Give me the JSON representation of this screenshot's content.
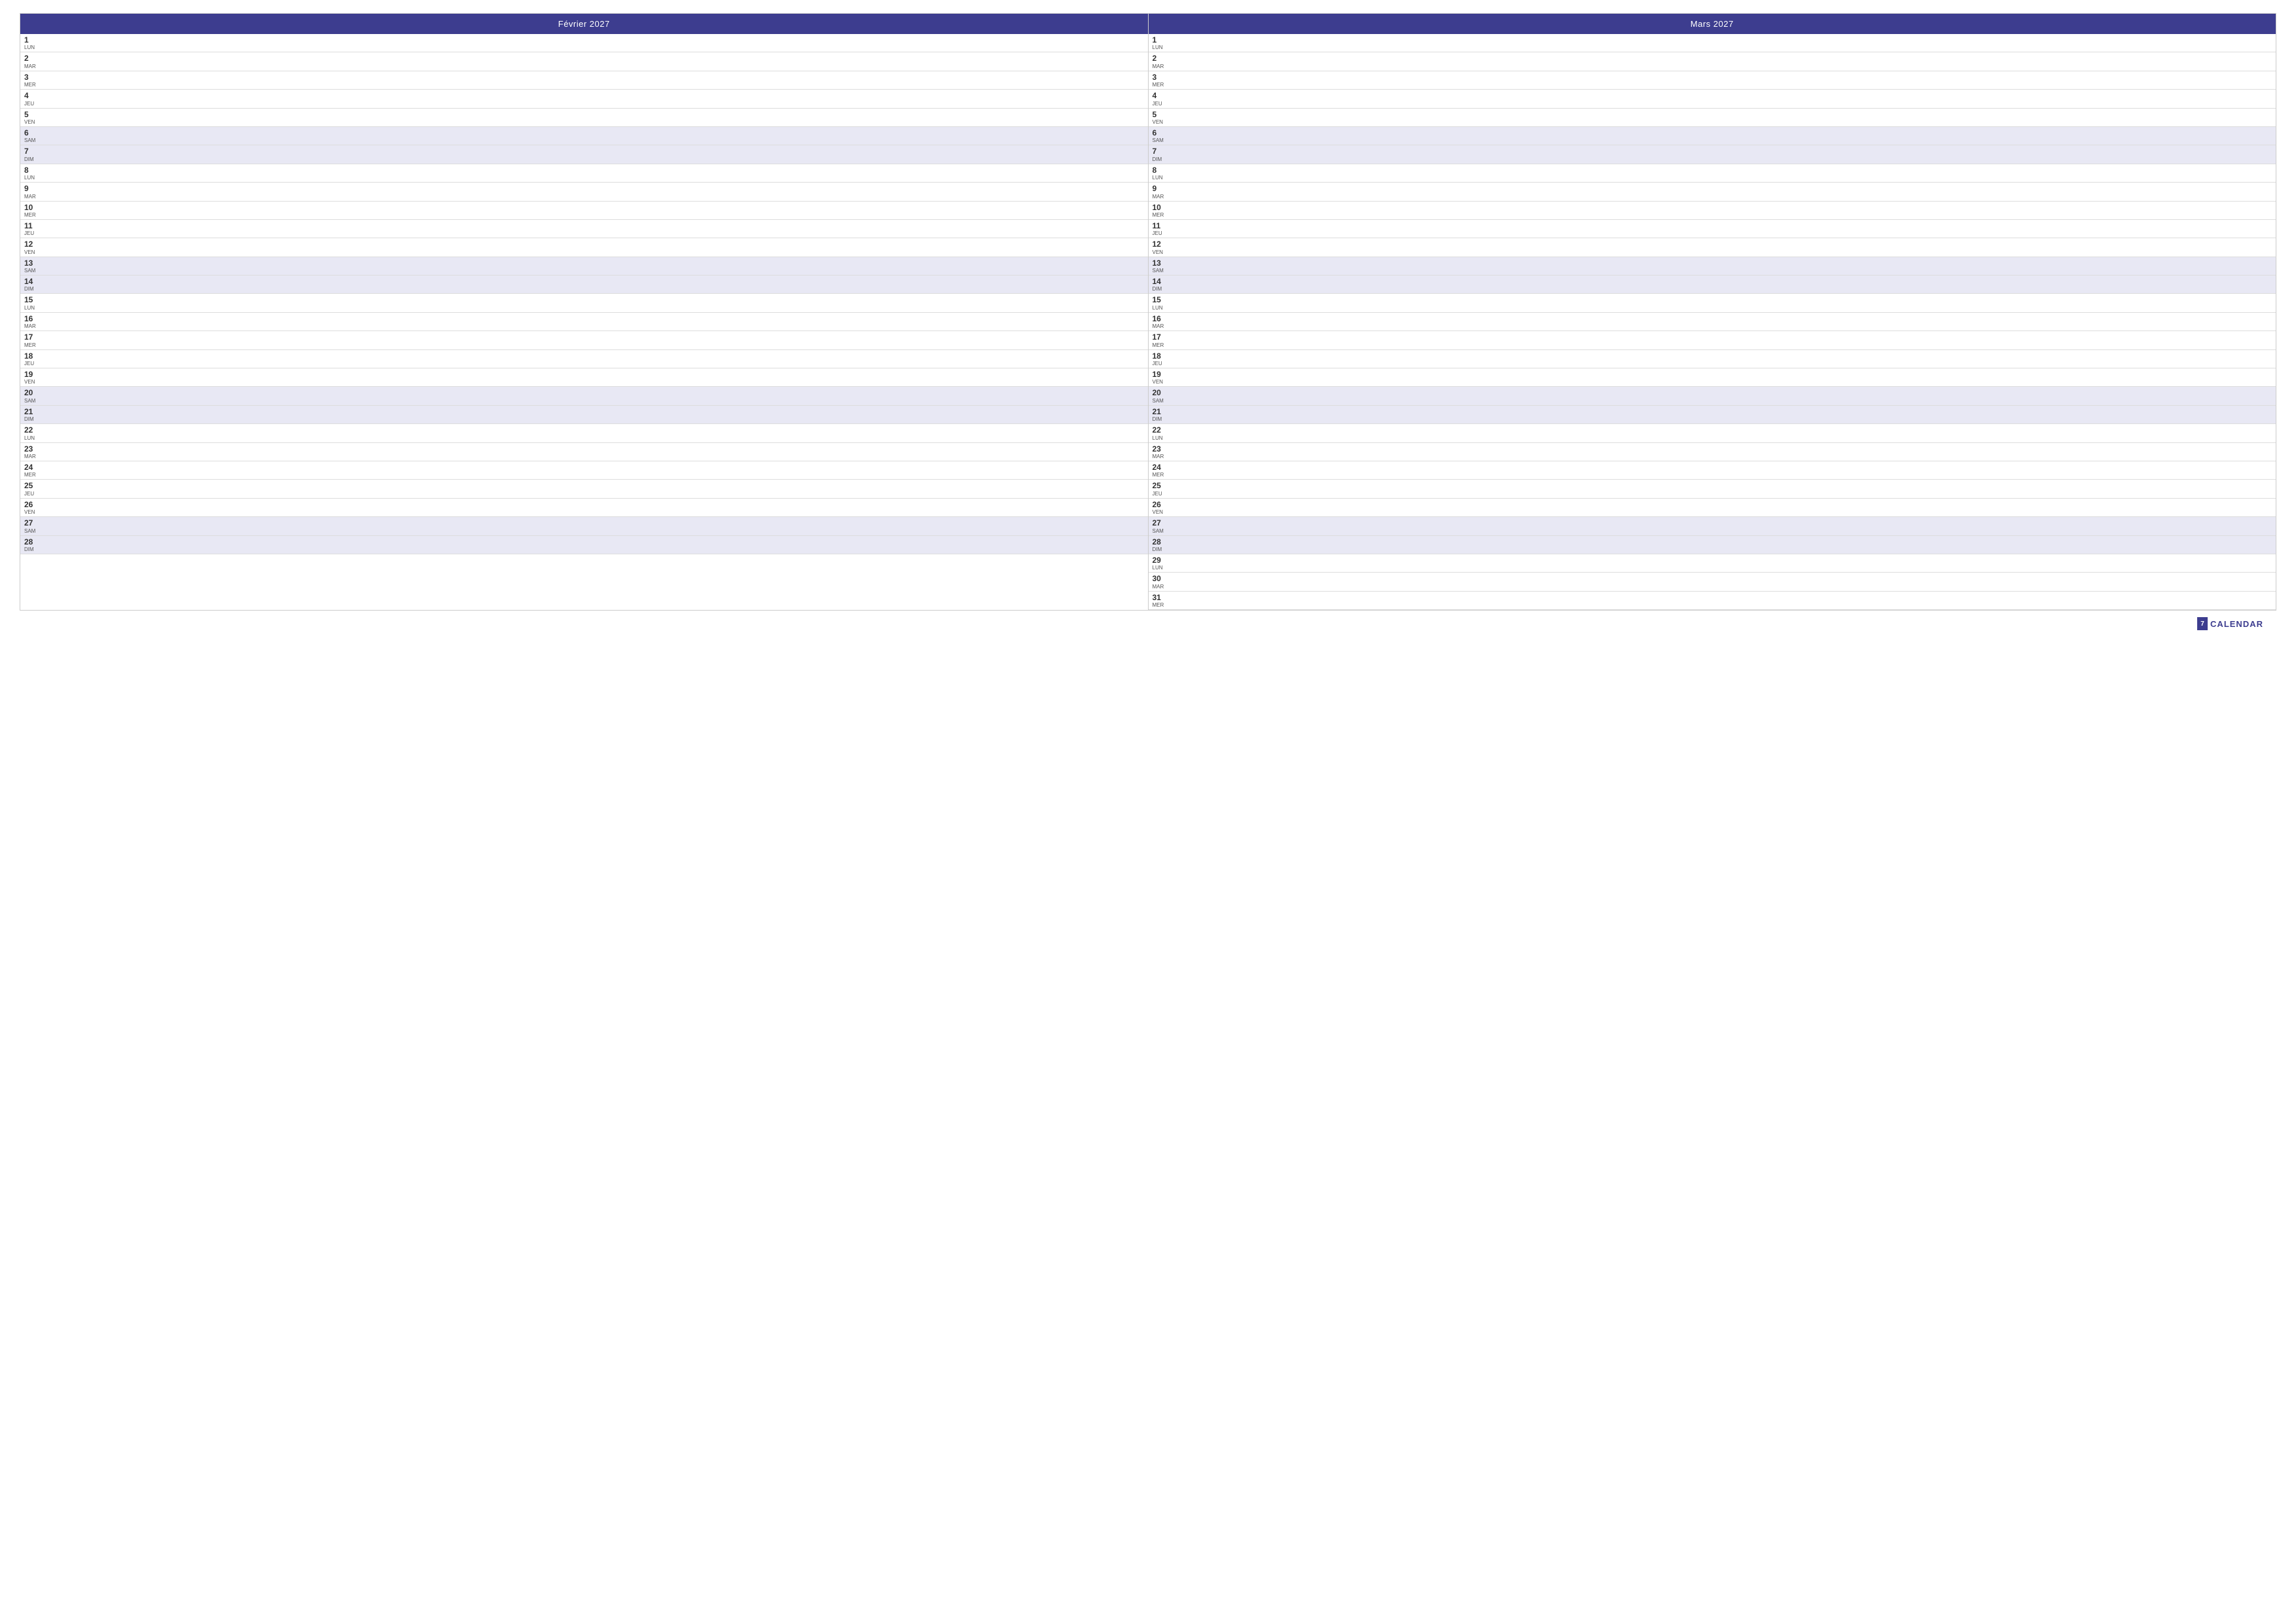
{
  "months": [
    {
      "id": "fevrier",
      "title": "Février 2027",
      "days": [
        {
          "number": "1",
          "name": "LUN",
          "weekend": false
        },
        {
          "number": "2",
          "name": "MAR",
          "weekend": false
        },
        {
          "number": "3",
          "name": "MER",
          "weekend": false
        },
        {
          "number": "4",
          "name": "JEU",
          "weekend": false
        },
        {
          "number": "5",
          "name": "VEN",
          "weekend": false
        },
        {
          "number": "6",
          "name": "SAM",
          "weekend": true
        },
        {
          "number": "7",
          "name": "DIM",
          "weekend": true
        },
        {
          "number": "8",
          "name": "LUN",
          "weekend": false
        },
        {
          "number": "9",
          "name": "MAR",
          "weekend": false
        },
        {
          "number": "10",
          "name": "MER",
          "weekend": false
        },
        {
          "number": "11",
          "name": "JEU",
          "weekend": false
        },
        {
          "number": "12",
          "name": "VEN",
          "weekend": false
        },
        {
          "number": "13",
          "name": "SAM",
          "weekend": true
        },
        {
          "number": "14",
          "name": "DIM",
          "weekend": true
        },
        {
          "number": "15",
          "name": "LUN",
          "weekend": false
        },
        {
          "number": "16",
          "name": "MAR",
          "weekend": false
        },
        {
          "number": "17",
          "name": "MER",
          "weekend": false
        },
        {
          "number": "18",
          "name": "JEU",
          "weekend": false
        },
        {
          "number": "19",
          "name": "VEN",
          "weekend": false
        },
        {
          "number": "20",
          "name": "SAM",
          "weekend": true
        },
        {
          "number": "21",
          "name": "DIM",
          "weekend": true
        },
        {
          "number": "22",
          "name": "LUN",
          "weekend": false
        },
        {
          "number": "23",
          "name": "MAR",
          "weekend": false
        },
        {
          "number": "24",
          "name": "MER",
          "weekend": false
        },
        {
          "number": "25",
          "name": "JEU",
          "weekend": false
        },
        {
          "number": "26",
          "name": "VEN",
          "weekend": false
        },
        {
          "number": "27",
          "name": "SAM",
          "weekend": true
        },
        {
          "number": "28",
          "name": "DIM",
          "weekend": true
        }
      ]
    },
    {
      "id": "mars",
      "title": "Mars 2027",
      "days": [
        {
          "number": "1",
          "name": "LUN",
          "weekend": false
        },
        {
          "number": "2",
          "name": "MAR",
          "weekend": false
        },
        {
          "number": "3",
          "name": "MER",
          "weekend": false
        },
        {
          "number": "4",
          "name": "JEU",
          "weekend": false
        },
        {
          "number": "5",
          "name": "VEN",
          "weekend": false
        },
        {
          "number": "6",
          "name": "SAM",
          "weekend": true
        },
        {
          "number": "7",
          "name": "DIM",
          "weekend": true
        },
        {
          "number": "8",
          "name": "LUN",
          "weekend": false
        },
        {
          "number": "9",
          "name": "MAR",
          "weekend": false
        },
        {
          "number": "10",
          "name": "MER",
          "weekend": false
        },
        {
          "number": "11",
          "name": "JEU",
          "weekend": false
        },
        {
          "number": "12",
          "name": "VEN",
          "weekend": false
        },
        {
          "number": "13",
          "name": "SAM",
          "weekend": true
        },
        {
          "number": "14",
          "name": "DIM",
          "weekend": true
        },
        {
          "number": "15",
          "name": "LUN",
          "weekend": false
        },
        {
          "number": "16",
          "name": "MAR",
          "weekend": false
        },
        {
          "number": "17",
          "name": "MER",
          "weekend": false
        },
        {
          "number": "18",
          "name": "JEU",
          "weekend": false
        },
        {
          "number": "19",
          "name": "VEN",
          "weekend": false
        },
        {
          "number": "20",
          "name": "SAM",
          "weekend": true
        },
        {
          "number": "21",
          "name": "DIM",
          "weekend": true
        },
        {
          "number": "22",
          "name": "LUN",
          "weekend": false
        },
        {
          "number": "23",
          "name": "MAR",
          "weekend": false
        },
        {
          "number": "24",
          "name": "MER",
          "weekend": false
        },
        {
          "number": "25",
          "name": "JEU",
          "weekend": false
        },
        {
          "number": "26",
          "name": "VEN",
          "weekend": false
        },
        {
          "number": "27",
          "name": "SAM",
          "weekend": true
        },
        {
          "number": "28",
          "name": "DIM",
          "weekend": true
        },
        {
          "number": "29",
          "name": "LUN",
          "weekend": false
        },
        {
          "number": "30",
          "name": "MAR",
          "weekend": false
        },
        {
          "number": "31",
          "name": "MER",
          "weekend": false
        }
      ]
    }
  ],
  "footer": {
    "icon_label": "7",
    "app_name": "CALENDAR"
  },
  "colors": {
    "header_bg": "#3d3d8f",
    "weekend_bg": "#e8e8f4",
    "weekday_bg": "#ffffff",
    "border": "#cccccc",
    "text": "#333333"
  }
}
